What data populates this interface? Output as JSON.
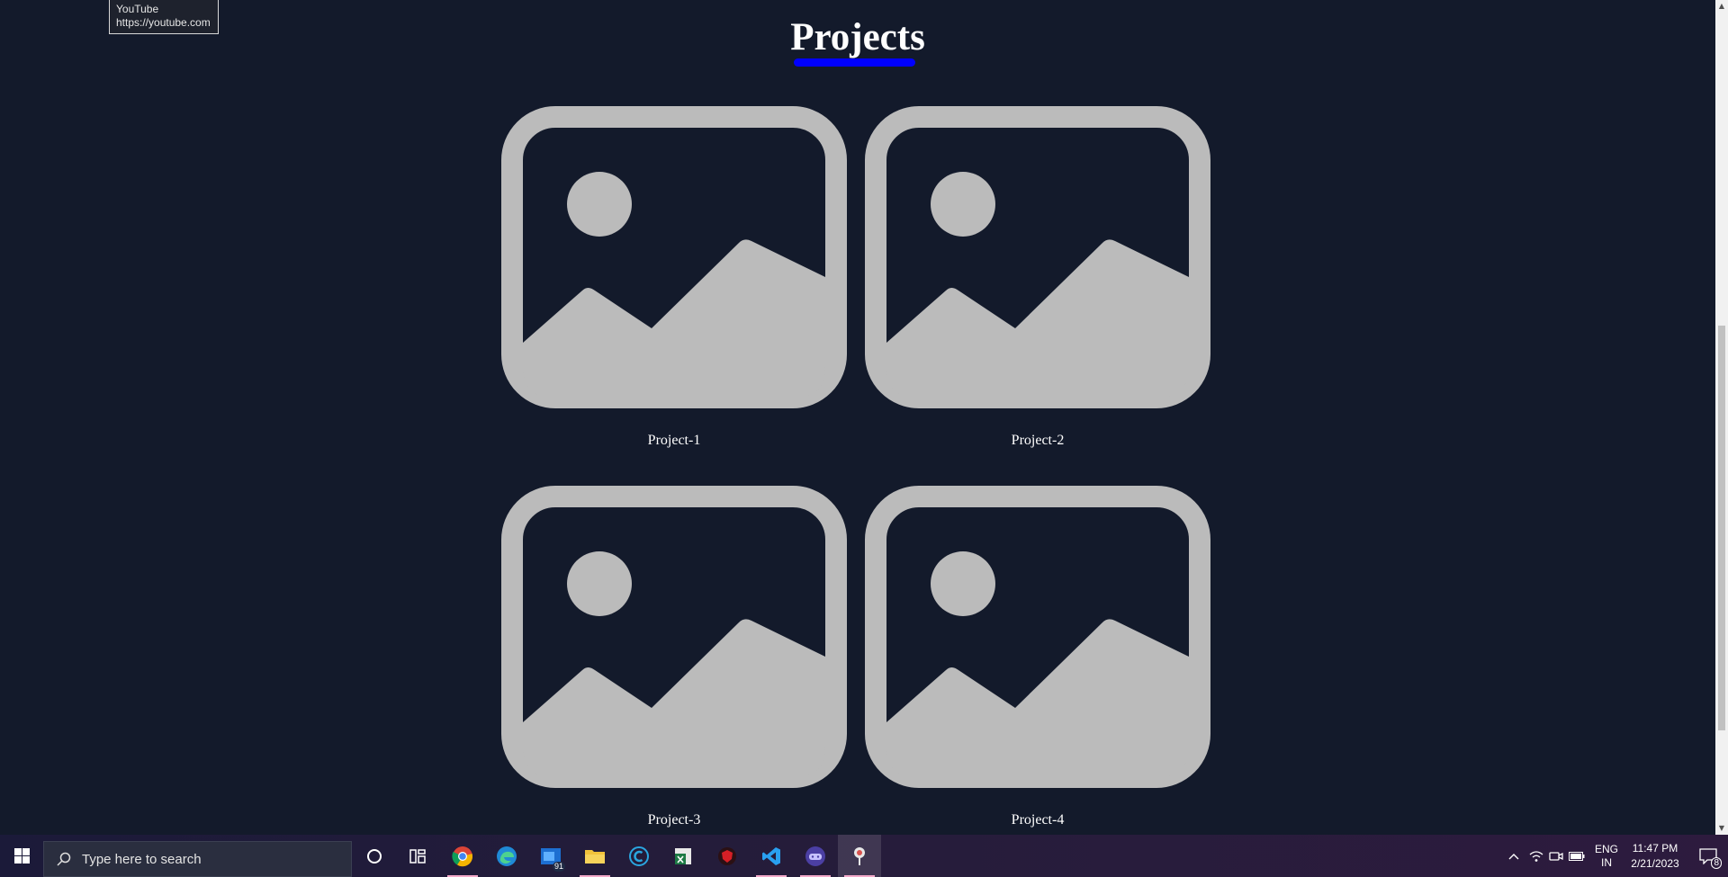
{
  "page": {
    "title": "Projects",
    "accent_color": "#0000ff",
    "background_color": "#131a2b",
    "placeholder_color": "#bbbbbb",
    "projects": [
      {
        "label": "Project-1",
        "icon": "image-placeholder-icon"
      },
      {
        "label": "Project-2",
        "icon": "image-placeholder-icon"
      },
      {
        "label": "Project-3",
        "icon": "image-placeholder-icon"
      },
      {
        "label": "Project-4",
        "icon": "image-placeholder-icon"
      }
    ]
  },
  "tooltip": {
    "title": "YouTube",
    "url": "https://youtube.com"
  },
  "taskbar": {
    "search_placeholder": "Type here to search",
    "apps": [
      {
        "name": "cortana",
        "icon": "circle-icon"
      },
      {
        "name": "task-view",
        "icon": "task-view-icon"
      },
      {
        "name": "chrome",
        "icon": "chrome-icon",
        "running": true
      },
      {
        "name": "edge",
        "icon": "edge-icon"
      },
      {
        "name": "mail",
        "icon": "mail-icon",
        "badge": "91"
      },
      {
        "name": "file-explorer",
        "icon": "folder-icon",
        "running": true
      },
      {
        "name": "ccleaner",
        "icon": "ccleaner-icon"
      },
      {
        "name": "excel",
        "icon": "excel-icon"
      },
      {
        "name": "antivirus",
        "icon": "shield-icon"
      },
      {
        "name": "vscode",
        "icon": "vscode-icon",
        "running": true
      },
      {
        "name": "discord-like",
        "icon": "gamepad-icon",
        "running": true
      },
      {
        "name": "sourcetree",
        "icon": "git-icon",
        "running": true,
        "active": true
      }
    ],
    "language": {
      "line1": "ENG",
      "line2": "IN"
    },
    "clock": {
      "time": "11:47 PM",
      "date": "2/21/2023"
    },
    "notifications_count": "8"
  }
}
